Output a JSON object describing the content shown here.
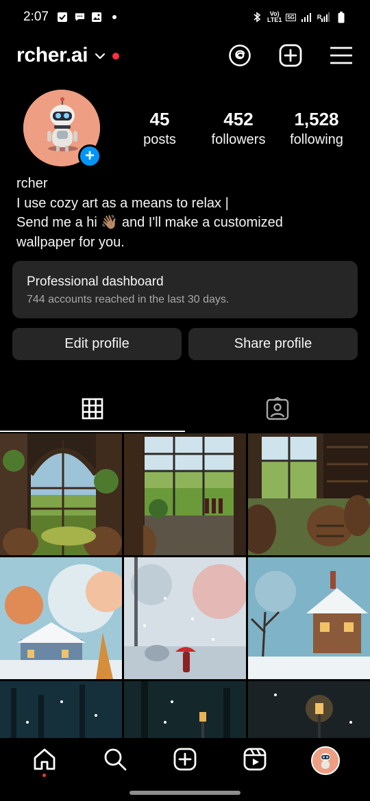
{
  "status_bar": {
    "time": "2:07",
    "network_top": "Vo)",
    "network_bottom": "LTE1",
    "network_5g": "5G",
    "signal_label": "R"
  },
  "header": {
    "username": "rcher.ai",
    "icons": [
      "threads-icon",
      "new-post-icon",
      "menu-icon"
    ],
    "notification_color": "#ff3040"
  },
  "profile": {
    "stats": [
      {
        "value": "45",
        "label": "posts"
      },
      {
        "value": "452",
        "label": "followers"
      },
      {
        "value": "1,528",
        "label": "following"
      }
    ],
    "bio": {
      "name": "rcher",
      "line1": "I use cozy art as a means to relax |",
      "line2": "Send me a hi 👋🏽 and I'll make a customized",
      "line3": "wallpaper for you."
    }
  },
  "dashboard": {
    "title": "Professional dashboard",
    "subtitle": "744 accounts reached in the last 30 days."
  },
  "actions": {
    "edit_label": "Edit profile",
    "share_label": "Share profile"
  },
  "tabs": [
    {
      "name": "grid-icon",
      "active": true
    },
    {
      "name": "tagged-icon",
      "active": false
    }
  ],
  "grid": {
    "posts": [
      "vineyard-arch-window",
      "vineyard-window-bottles",
      "wine-cellar-barrels",
      "snowy-village-autumn",
      "snowy-street-umbrella",
      "snowy-house",
      "night-forest",
      "night-forest-lamp",
      "night-lamp"
    ]
  },
  "bottom_nav": {
    "items": [
      "home-icon",
      "search-icon",
      "create-icon",
      "reels-icon",
      "profile-avatar"
    ]
  },
  "colors": {
    "background": "#000000",
    "card": "#262626",
    "accent_blue": "#0095f6",
    "avatar_bg": "#ee9e82"
  }
}
